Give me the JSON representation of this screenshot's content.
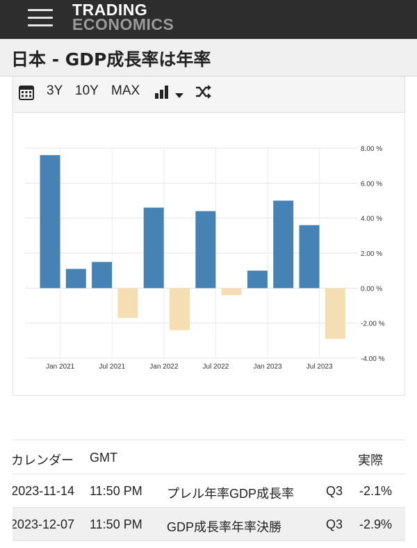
{
  "header": {
    "logo_line1": "TRADING",
    "logo_line2": "ECONOMICS",
    "menu_icon": "hamburger-menu-icon"
  },
  "page": {
    "title": "日本 - GDP成長率は年率"
  },
  "toolbar": {
    "calendar_icon": "calendar-icon",
    "range_3y": "3Y",
    "range_10y": "10Y",
    "range_max": "MAX",
    "chart_type_icon": "bar-chart-icon",
    "dropdown_icon": "chevron-down-icon",
    "compare_icon": "shuffle-icon"
  },
  "chart_data": {
    "type": "bar",
    "categories": [
      "2021 Q1",
      "2021 Q2",
      "2021 Q3",
      "2021 Q4",
      "2022 Q1",
      "2022 Q2",
      "2022 Q3",
      "2022 Q4",
      "2023 Q1",
      "2023 Q2",
      "2023 Q3",
      "2023 Q4"
    ],
    "values": [
      7.6,
      1.1,
      1.5,
      -1.7,
      4.6,
      -2.4,
      4.4,
      -0.4,
      1.0,
      5.0,
      3.6,
      -2.9
    ],
    "x_tick_labels": [
      "Jan 2021",
      "Jul 2021",
      "Jan 2022",
      "Jul 2022",
      "Jan 2023",
      "Jul 2023"
    ],
    "y_tick_labels": [
      "8.00 %",
      "6.00 %",
      "4.00 %",
      "2.00 %",
      "0.00 %",
      "-2.00 %",
      "-4.00 %"
    ],
    "ylim": [
      -4,
      8
    ],
    "grid": true,
    "colors": {
      "positive": "#4682b4",
      "negative": "#f5deb3"
    }
  },
  "calendar_table": {
    "headers": {
      "calendar": "カレンダー",
      "gmt": "GMT",
      "actual": "実際"
    },
    "rows": [
      {
        "date": "2023-11-14",
        "time": "11:50 PM",
        "event": "プレル年率GDP成長率",
        "period": "Q3",
        "actual": "-2.1%"
      },
      {
        "date": "2023-12-07",
        "time": "11:50 PM",
        "event": "GDP成長率年率決勝",
        "period": "Q3",
        "actual": "-2.9%"
      }
    ]
  }
}
